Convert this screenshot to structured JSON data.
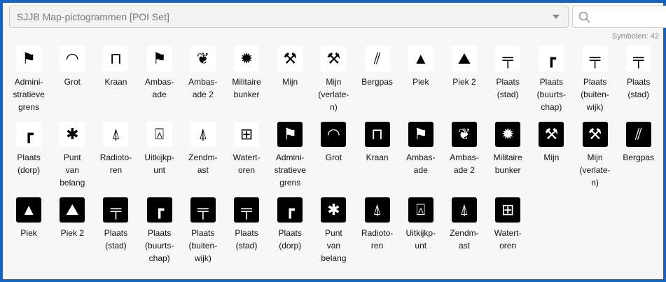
{
  "dropdown": {
    "value": "SJJB Map-pictogrammen [POI Set]"
  },
  "search": {
    "placeholder": ""
  },
  "count_label": "Symbolen: 42",
  "icon_map": {
    "admin": "⚑",
    "grot": "◠",
    "kraan": "⊓",
    "ambassade": "⚑",
    "ambassade2": "❦",
    "bunker": "✹",
    "mijn": "⚒",
    "mijn_verlaten": "⚒",
    "bergpas": "⫽",
    "piek": "▲",
    "piek2": "⛰",
    "stad": "╤",
    "buurtschap": "┏",
    "buitenwijk": "╤",
    "dorp": "┏",
    "punt": "✱",
    "radio": "⍋",
    "uitkijk": "⍓",
    "zendmast": "⍋",
    "watertoren": "⊞"
  },
  "items": [
    {
      "label": "Admini-\nstratieve\ngrens",
      "icon": "admin",
      "inv": false
    },
    {
      "label": "Grot",
      "icon": "grot",
      "inv": false
    },
    {
      "label": "Kraan",
      "icon": "kraan",
      "inv": false
    },
    {
      "label": "Ambas-\nade",
      "icon": "ambassade",
      "inv": false
    },
    {
      "label": "Ambas-\nade 2",
      "icon": "ambassade2",
      "inv": false
    },
    {
      "label": "Militaire\nbunker",
      "icon": "bunker",
      "inv": false
    },
    {
      "label": "Mijn",
      "icon": "mijn",
      "inv": false
    },
    {
      "label": "Mijn\n(verlate-\nn)",
      "icon": "mijn_verlaten",
      "inv": false
    },
    {
      "label": "Bergpas",
      "icon": "bergpas",
      "inv": false
    },
    {
      "label": "Piek",
      "icon": "piek",
      "inv": false
    },
    {
      "label": "Piek 2",
      "icon": "piek2",
      "inv": false
    },
    {
      "label": "Plaats\n(stad)",
      "icon": "stad",
      "inv": false
    },
    {
      "label": "Plaats\n(buurts-\nchap)",
      "icon": "buurtschap",
      "inv": false
    },
    {
      "label": "Plaats\n(buiten-\nwijk)",
      "icon": "buitenwijk",
      "inv": false
    },
    {
      "label": "Plaats\n(stad)",
      "icon": "stad",
      "inv": false
    },
    {
      "label": "Plaats\n(dorp)",
      "icon": "dorp",
      "inv": false
    },
    {
      "label": "Punt\nvan\nbelang",
      "icon": "punt",
      "inv": false
    },
    {
      "label": "Radioto-\nren",
      "icon": "radio",
      "inv": false
    },
    {
      "label": "Uitkijkp-\nunt",
      "icon": "uitkijk",
      "inv": false
    },
    {
      "label": "Zendm-\nast",
      "icon": "zendmast",
      "inv": false
    },
    {
      "label": "Watert-\noren",
      "icon": "watertoren",
      "inv": false
    },
    {
      "label": "Admini-\nstratieve\ngrens",
      "icon": "admin",
      "inv": true
    },
    {
      "label": "Grot",
      "icon": "grot",
      "inv": true
    },
    {
      "label": "Kraan",
      "icon": "kraan",
      "inv": true
    },
    {
      "label": "Ambas-\nade",
      "icon": "ambassade",
      "inv": true
    },
    {
      "label": "Ambas-\nade 2",
      "icon": "ambassade2",
      "inv": true
    },
    {
      "label": "Militaire\nbunker",
      "icon": "bunker",
      "inv": true
    },
    {
      "label": "Mijn",
      "icon": "mijn",
      "inv": true
    },
    {
      "label": "Mijn\n(verlate-\nn)",
      "icon": "mijn_verlaten",
      "inv": true
    },
    {
      "label": "Bergpas",
      "icon": "bergpas",
      "inv": true
    },
    {
      "label": "Piek",
      "icon": "piek",
      "inv": true
    },
    {
      "label": "Piek 2",
      "icon": "piek2",
      "inv": true
    },
    {
      "label": "Plaats\n(stad)",
      "icon": "stad",
      "inv": true
    },
    {
      "label": "Plaats\n(buurts-\nchap)",
      "icon": "buurtschap",
      "inv": true
    },
    {
      "label": "Plaats\n(buiten-\nwijk)",
      "icon": "buitenwijk",
      "inv": true
    },
    {
      "label": "Plaats\n(stad)",
      "icon": "stad",
      "inv": true
    },
    {
      "label": "Plaats\n(dorp)",
      "icon": "dorp",
      "inv": true
    },
    {
      "label": "Punt\nvan\nbelang",
      "icon": "punt",
      "inv": true
    },
    {
      "label": "Radioto-\nren",
      "icon": "radio",
      "inv": true
    },
    {
      "label": "Uitkijkp-\nunt",
      "icon": "uitkijk",
      "inv": true
    },
    {
      "label": "Zendm-\nast",
      "icon": "zendmast",
      "inv": true
    },
    {
      "label": "Watert-\noren",
      "icon": "watertoren",
      "inv": true
    }
  ]
}
